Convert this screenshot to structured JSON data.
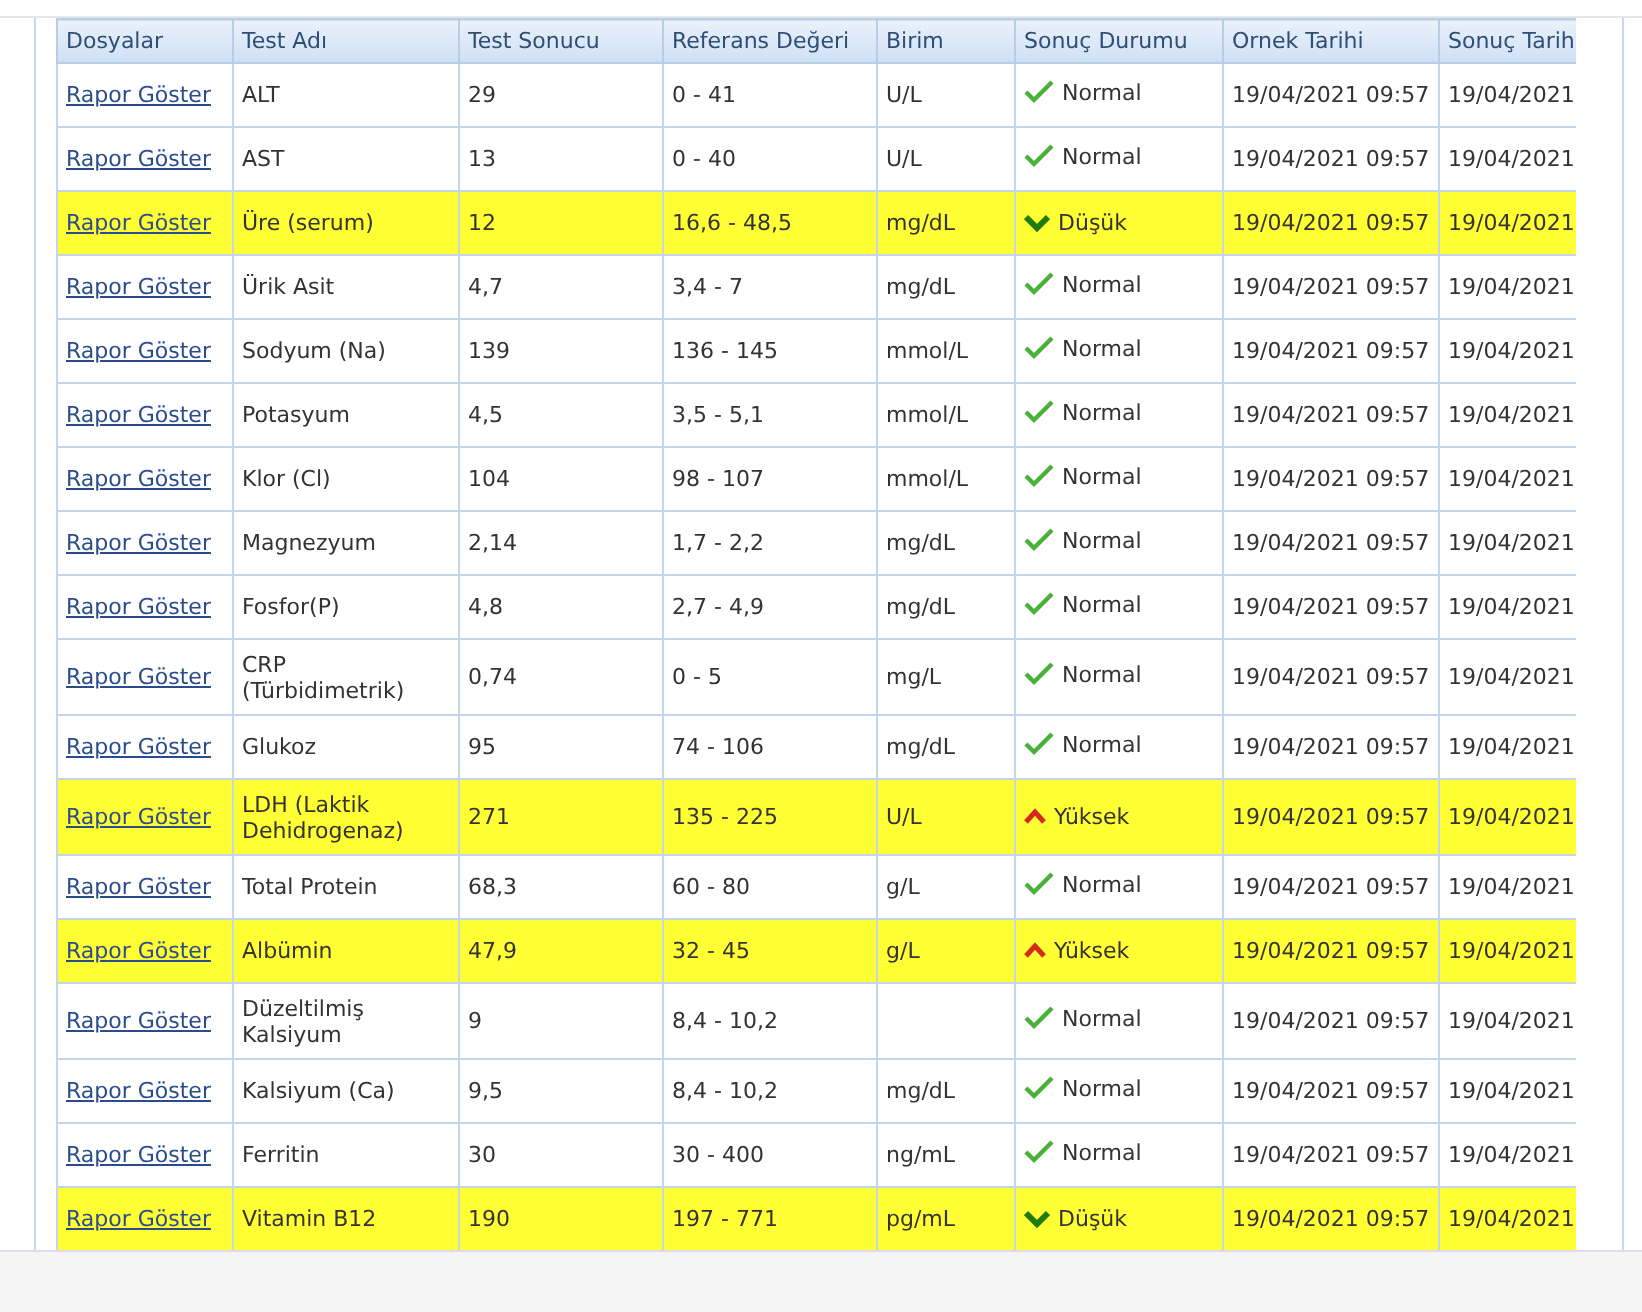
{
  "table": {
    "columns": [
      "Dosyalar",
      "Test Adı",
      "Test Sonucu",
      "Referans Değeri",
      "Birim",
      "Sonuç Durumu",
      "Ornek Tarihi",
      "Sonuç Tarih"
    ],
    "rows": [
      {
        "link": "Rapor Göster",
        "test": "ALT",
        "result": "29",
        "reference": "0 - 41",
        "unit": "U/L",
        "status": {
          "kind": "normal",
          "label": "Normal"
        },
        "sample_date": "19/04/2021 09:57",
        "result_date": "19/04/2021",
        "highlighted": false
      },
      {
        "link": "Rapor Göster",
        "test": "AST",
        "result": "13",
        "reference": "0 - 40",
        "unit": "U/L",
        "status": {
          "kind": "normal",
          "label": "Normal"
        },
        "sample_date": "19/04/2021 09:57",
        "result_date": "19/04/2021",
        "highlighted": false
      },
      {
        "link": "Rapor Göster",
        "test": "Üre (serum)",
        "result": "12",
        "reference": "16,6 - 48,5",
        "unit": "mg/dL",
        "status": {
          "kind": "low",
          "label": "Düşük"
        },
        "sample_date": "19/04/2021 09:57",
        "result_date": "19/04/2021",
        "highlighted": true
      },
      {
        "link": "Rapor Göster",
        "test": "Ürik Asit",
        "result": "4,7",
        "reference": "3,4 - 7",
        "unit": "mg/dL",
        "status": {
          "kind": "normal",
          "label": "Normal"
        },
        "sample_date": "19/04/2021 09:57",
        "result_date": "19/04/2021",
        "highlighted": false
      },
      {
        "link": "Rapor Göster",
        "test": "Sodyum (Na)",
        "result": "139",
        "reference": "136 - 145",
        "unit": "mmol/L",
        "status": {
          "kind": "normal",
          "label": "Normal"
        },
        "sample_date": "19/04/2021 09:57",
        "result_date": "19/04/2021",
        "highlighted": false
      },
      {
        "link": "Rapor Göster",
        "test": "Potasyum",
        "result": "4,5",
        "reference": "3,5 - 5,1",
        "unit": "mmol/L",
        "status": {
          "kind": "normal",
          "label": "Normal"
        },
        "sample_date": "19/04/2021 09:57",
        "result_date": "19/04/2021",
        "highlighted": false
      },
      {
        "link": "Rapor Göster",
        "test": "Klor (Cl)",
        "result": "104",
        "reference": "98 - 107",
        "unit": "mmol/L",
        "status": {
          "kind": "normal",
          "label": "Normal"
        },
        "sample_date": "19/04/2021 09:57",
        "result_date": "19/04/2021",
        "highlighted": false
      },
      {
        "link": "Rapor Göster",
        "test": "Magnezyum",
        "result": "2,14",
        "reference": "1,7 - 2,2",
        "unit": "mg/dL",
        "status": {
          "kind": "normal",
          "label": "Normal"
        },
        "sample_date": "19/04/2021 09:57",
        "result_date": "19/04/2021",
        "highlighted": false
      },
      {
        "link": "Rapor Göster",
        "test": "Fosfor(P)",
        "result": "4,8",
        "reference": "2,7 - 4,9",
        "unit": "mg/dL",
        "status": {
          "kind": "normal",
          "label": "Normal"
        },
        "sample_date": "19/04/2021 09:57",
        "result_date": "19/04/2021",
        "highlighted": false
      },
      {
        "link": "Rapor Göster",
        "test": "CRP (Türbidimetrik)",
        "result": "0,74",
        "reference": "0 - 5",
        "unit": "mg/L",
        "status": {
          "kind": "normal",
          "label": "Normal"
        },
        "sample_date": "19/04/2021 09:57",
        "result_date": "19/04/2021",
        "highlighted": false
      },
      {
        "link": "Rapor Göster",
        "test": "Glukoz",
        "result": "95",
        "reference": "74 - 106",
        "unit": "mg/dL",
        "status": {
          "kind": "normal",
          "label": "Normal"
        },
        "sample_date": "19/04/2021 09:57",
        "result_date": "19/04/2021",
        "highlighted": false
      },
      {
        "link": "Rapor Göster",
        "test": "LDH (Laktik Dehidrogenaz)",
        "result": "271",
        "reference": "135 - 225",
        "unit": "U/L",
        "status": {
          "kind": "high",
          "label": "Yüksek"
        },
        "sample_date": "19/04/2021 09:57",
        "result_date": "19/04/2021",
        "highlighted": true
      },
      {
        "link": "Rapor Göster",
        "test": "Total Protein",
        "result": "68,3",
        "reference": "60 - 80",
        "unit": "g/L",
        "status": {
          "kind": "normal",
          "label": "Normal"
        },
        "sample_date": "19/04/2021 09:57",
        "result_date": "19/04/2021",
        "highlighted": false
      },
      {
        "link": "Rapor Göster",
        "test": "Albümin",
        "result": "47,9",
        "reference": "32 - 45",
        "unit": "g/L",
        "status": {
          "kind": "high",
          "label": "Yüksek"
        },
        "sample_date": "19/04/2021 09:57",
        "result_date": "19/04/2021",
        "highlighted": true
      },
      {
        "link": "Rapor Göster",
        "test": "Düzeltilmiş Kalsiyum",
        "result": "9",
        "reference": "8,4 - 10,2",
        "status": {
          "kind": "normal",
          "label": "Normal"
        },
        "sample_date": "19/04/2021 09:57",
        "result_date": "19/04/2021",
        "highlighted": false
      },
      {
        "link": "Rapor Göster",
        "test": "Kalsiyum (Ca)",
        "result": "9,5",
        "reference": "8,4 - 10,2",
        "unit": "mg/dL",
        "status": {
          "kind": "normal",
          "label": "Normal"
        },
        "sample_date": "19/04/2021 09:57",
        "result_date": "19/04/2021",
        "highlighted": false
      },
      {
        "link": "Rapor Göster",
        "test": "Ferritin",
        "result": "30",
        "reference": "30 - 400",
        "unit": "ng/mL",
        "status": {
          "kind": "normal",
          "label": "Normal"
        },
        "sample_date": "19/04/2021 09:57",
        "result_date": "19/04/2021",
        "highlighted": false
      },
      {
        "link": "Rapor Göster",
        "test": "Vitamin B12",
        "result": "190",
        "reference": "197 - 771",
        "unit": "pg/mL",
        "status": {
          "kind": "low",
          "label": "Düşük"
        },
        "sample_date": "19/04/2021 09:57",
        "result_date": "19/04/2021",
        "highlighted": true
      }
    ]
  }
}
